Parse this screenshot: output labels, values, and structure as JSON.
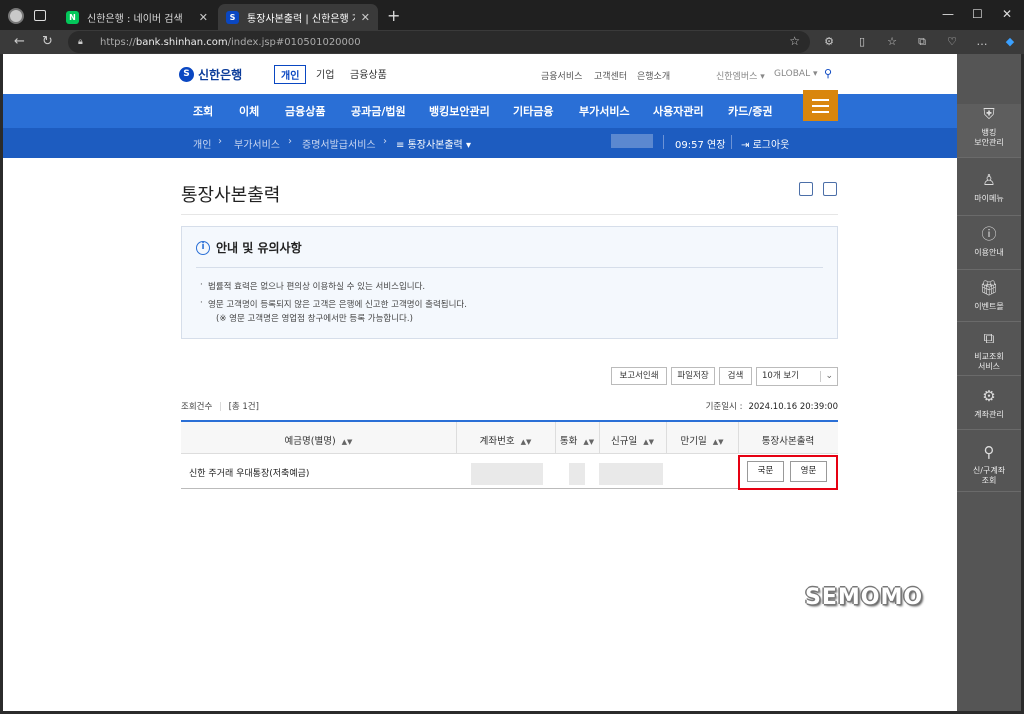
{
  "browser": {
    "tabs": [
      {
        "title": "신한은행 : 네이버 검색",
        "favicon": "N",
        "favicon_color": "#03c75a"
      },
      {
        "title": "통장사본출력 | 신한은행 개인뱅킹",
        "favicon": "S",
        "favicon_color": "#0a47c2"
      }
    ],
    "url_scheme": "https://",
    "url_host": "bank.shinhan.com",
    "url_path": "/index.jsp#010501020000"
  },
  "site": {
    "logo": "신한은행",
    "segments": [
      "개인",
      "기업",
      "금융상품"
    ],
    "util_links": [
      "금융서비스",
      "고객센터",
      "은행소개"
    ],
    "util_right": [
      "신한엠버스",
      "GLOBAL"
    ],
    "gnb": [
      "조회",
      "이체",
      "금융상품",
      "공과금/법원",
      "뱅킹보안관리",
      "기타금융",
      "부가서비스",
      "사용자관리",
      "카드/증권"
    ],
    "breadcrumb": [
      "개인",
      "부가서비스",
      "증명서발급서비스",
      "통장사본출력"
    ],
    "session_time": "09:57",
    "extend_label": "연장",
    "logout_label": "로그아웃"
  },
  "page": {
    "title": "통장사본출력",
    "notice": {
      "heading": "안내 및 유의사항",
      "items": [
        "법률적 효력은 없으나 편의상 이용하실 수 있는 서비스입니다.",
        "영문 고객명이 등록되지 않은 고객은 은행에 신고한 고객명이 출력됩니다."
      ],
      "subnote": "(※ 영문 고객명은 영업점 창구에서만 등록 가능합니다.)"
    },
    "buttons": {
      "print_report": "보고서인쇄",
      "save_file": "파일저장",
      "search": "검색"
    },
    "page_size": "10개 보기",
    "count_label": "조회건수",
    "count_value": "[총 1건]",
    "base_date_label": "기준일시 :",
    "base_date_value": "2024.10.16 20:39:00",
    "columns": [
      "예금명(별명)",
      "계좌번호",
      "통화",
      "신규일",
      "만기일",
      "통장사본출력"
    ],
    "rows": [
      {
        "name": "신한 주거래 우대통장(저축예금)",
        "btn_korean": "국문",
        "btn_english": "영문"
      }
    ]
  },
  "sidepanel": [
    "뱅킹\n보안관리",
    "마이메뉴",
    "이용안내",
    "이벤트몰",
    "비교조회\n서비스",
    "계좌관리",
    "신/구계좌\n조회"
  ],
  "watermark": "SEMOMO"
}
